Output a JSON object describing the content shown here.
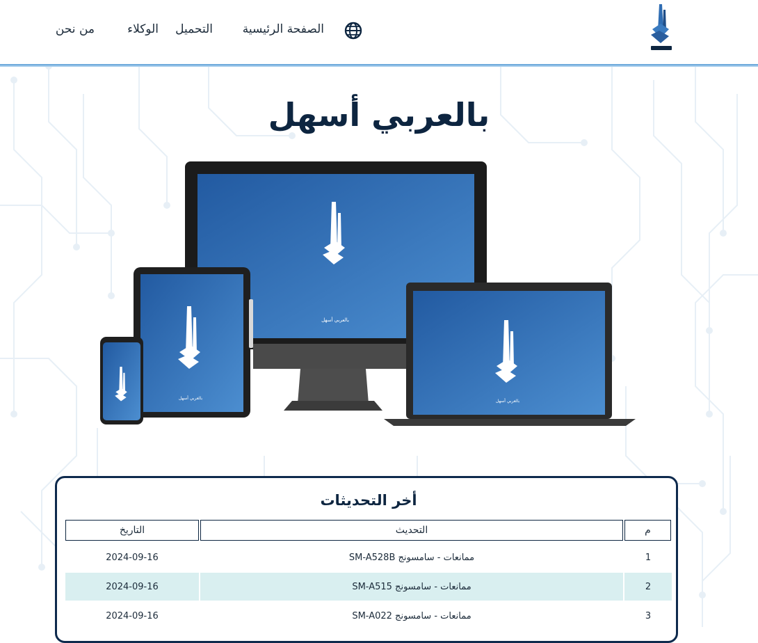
{
  "header": {
    "logo_alt": "بالعربي أسهل",
    "nav": [
      {
        "label": "الصفحة الرئيسية"
      },
      {
        "label": "التحميل"
      },
      {
        "label": "الوكلاء"
      },
      {
        "label": "من نحن"
      }
    ],
    "language_icon": "globe-icon"
  },
  "hero": {
    "title": "بالعربي أسهل",
    "device_caption": "بالعربي أسهل"
  },
  "updates": {
    "title": "أخر التحديثات",
    "columns": {
      "index": "م",
      "update": "التحديث",
      "date": "التاريخ"
    },
    "rows": [
      {
        "index": "1",
        "update": "ممانعات - سامسونج SM-A528B",
        "date": "2024-09-16"
      },
      {
        "index": "2",
        "update": "ممانعات - سامسونج SM-A515",
        "date": "2024-09-16"
      },
      {
        "index": "3",
        "update": "ممانعات - سامسونج SM-A022",
        "date": "2024-09-16"
      }
    ]
  },
  "colors": {
    "brand_navy": "#0d2540",
    "accent_blue": "#3a7bc0",
    "row_stripe": "#d9eff0"
  }
}
